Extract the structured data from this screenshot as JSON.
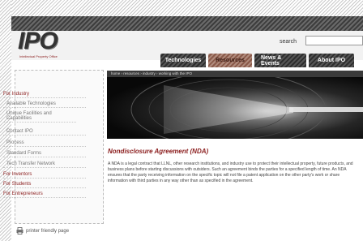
{
  "header": {
    "logo_text": "IPO",
    "logo_subtitle": "Intellectual Property Office",
    "search_label": "search",
    "search_value": ""
  },
  "nav": {
    "tabs": [
      {
        "label": "Technologies",
        "active": false
      },
      {
        "label": "Resources",
        "active": true
      },
      {
        "label": "News & Events",
        "active": false
      },
      {
        "label": "About IPO",
        "active": false
      }
    ]
  },
  "sidebar": {
    "items": [
      {
        "label": "For Industry",
        "level": 0
      },
      {
        "label": "Available Technologies",
        "level": 1
      },
      {
        "label": "Unique Facilities and Capabilities",
        "level": 1
      },
      {
        "label": "Contact IPO",
        "level": 1
      },
      {
        "label": "Process",
        "level": 1
      },
      {
        "label": "Standard Forms",
        "level": 1
      },
      {
        "label": "Tech Transfer Network",
        "level": 1
      },
      {
        "label": "For Inventors",
        "level": 0
      },
      {
        "label": "For Students",
        "level": 0
      },
      {
        "label": "For Entrepreneurs",
        "level": 0
      }
    ],
    "print_label": "printer friendly page"
  },
  "main": {
    "breadcrumb": "home › resources › industry › working with the IPO",
    "title": "Nondisclosure Agreement (NDA)",
    "body": "A NDA is a legal contract that LLNL, other research institutions, and industry use to protect their intellectual property, future products, and business plans before starting discussions with outsiders. Such an agreement binds the parties for a specified length of time. An NDA ensures that the party receiving information on the specific topic will not file a patent application on the other party's work or share information with third parties in any way other than as specified in the agreement."
  }
}
